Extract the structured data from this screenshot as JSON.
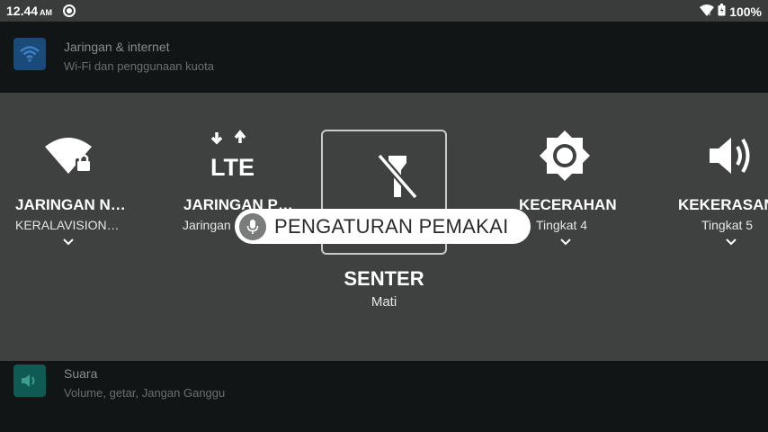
{
  "status_bar": {
    "time": "12.44",
    "ampm": "AM",
    "battery": "100%"
  },
  "settings_rows": [
    {
      "title": "Jaringan & internet",
      "subtitle": "Wi-Fi dan penggunaan kuota",
      "icon": "wifi-icon",
      "color": "#1a4a7a"
    },
    {
      "title": "Suara",
      "subtitle": "Volume, getar, Jangan Ganggu",
      "icon": "volume-icon",
      "color": "#0f5a52"
    }
  ],
  "quick_settings": {
    "tiles": [
      {
        "label": "JARINGAN N…",
        "sub": "KERALAVISION…",
        "icon": "wifi-lock-icon"
      },
      {
        "label": "JARINGAN P…",
        "sub": "Jaringan",
        "icon": "lte-icon"
      },
      {
        "label": "SENTER",
        "sub": "Mati",
        "icon": "flashlight-off-icon"
      },
      {
        "label": "KECERAHAN",
        "sub": "Tingkat 4",
        "icon": "brightness-icon"
      },
      {
        "label": "KEKERASAN",
        "sub": "Tingkat 5",
        "icon": "volume-icon"
      }
    ]
  },
  "toast": {
    "text": "PENGATURAN PEMAKAI",
    "icon": "mic-icon"
  }
}
